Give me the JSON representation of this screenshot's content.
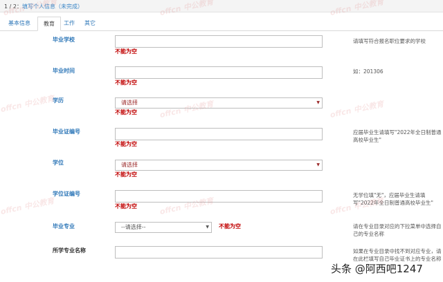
{
  "progress": {
    "step": "1 / 2",
    "separator": "：",
    "info": "填写个人信息（未完成）"
  },
  "tabs": [
    "基本信息",
    "教育",
    "工作",
    "其它"
  ],
  "fields": {
    "school": {
      "label": "毕业学校",
      "error": "不能为空",
      "hint": "请填写符合报名职位要求的学校"
    },
    "grad_time": {
      "label": "毕业时间",
      "error": "不能为空",
      "hint": "如：201306"
    },
    "education": {
      "label": "学历",
      "select": "请选择",
      "error": "不能为空"
    },
    "diploma_no": {
      "label": "毕业证编号",
      "error": "不能为空",
      "hint": "应届毕业生请填写\"2022年全日制普通高校毕业生\""
    },
    "degree": {
      "label": "学位",
      "select": "请选择",
      "error": "不能为空"
    },
    "degree_no": {
      "label": "学位证编号",
      "error": "不能为空",
      "hint": "无学位填\"无\"，应届毕业生请填写\"2022年全日制普通高校毕业生\""
    },
    "major": {
      "label": "毕业专业",
      "select": "--请选择--",
      "error": "不能为空",
      "hint": "请在专业目录对应的下拉菜单中选择自己的专业名称"
    },
    "major_name": {
      "label": "所学专业名称",
      "hint": "如果在专业目录中找不到对应专业，请在此栏填写自己毕业证书上的专业名称"
    }
  },
  "watermark": {
    "logo": "offcn",
    "text": "中公教育"
  },
  "credit": "头条 @阿西吧1247"
}
